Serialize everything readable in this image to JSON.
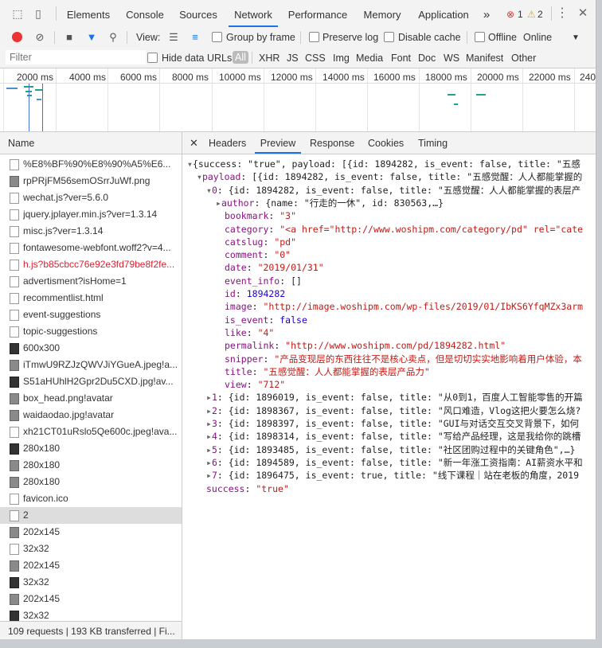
{
  "tabs": [
    "Elements",
    "Console",
    "Sources",
    "Network",
    "Performance",
    "Memory",
    "Application"
  ],
  "more_tabs": "»",
  "errors": "1",
  "warnings": "2",
  "toolbar": {
    "view_label": "View:",
    "group_by_frame": "Group by frame",
    "preserve_log": "Preserve log",
    "disable_cache": "Disable cache",
    "offline": "Offline",
    "throttle": "Online"
  },
  "filter": {
    "placeholder": "Filter",
    "hide_data_urls": "Hide data URLs",
    "types": [
      "All",
      "XHR",
      "JS",
      "CSS",
      "Img",
      "Media",
      "Font",
      "Doc",
      "WS",
      "Manifest",
      "Other"
    ]
  },
  "timeline_ticks": [
    "2000 ms",
    "4000 ms",
    "6000 ms",
    "8000 ms",
    "10000 ms",
    "12000 ms",
    "14000 ms",
    "16000 ms",
    "18000 ms",
    "20000 ms",
    "22000 ms",
    "240"
  ],
  "list": {
    "header": "Name",
    "rows": [
      "%E8%BF%90%E8%90%A5%E6...",
      "rpPRjFM56semOSrrJuWf.png",
      "wechat.js?ver=5.6.0",
      "jquery.jplayer.min.js?ver=1.3.14",
      "misc.js?ver=1.3.14",
      "fontawesome-webfont.woff2?v=4...",
      "h.js?b85cbcc76e92e3fd79be8f2fe...",
      "advertisment?isHome=1",
      "recommentlist.html",
      "event-suggestions",
      "topic-suggestions",
      "600x300",
      "iTmwU9RZJzQWVJiYGueA.jpeg!a...",
      "S51aHUhlH2Gpr2Du5CXD.jpg!av...",
      "box_head.png!avatar",
      "waidaodao.jpg!avatar",
      "xh21CT01uRslo5Qe600c.jpeg!ava...",
      "280x180",
      "280x180",
      "280x180",
      "favicon.ico",
      "2",
      "202x145",
      "32x32",
      "202x145",
      "32x32",
      "202x145",
      "32x32"
    ],
    "status": "109 requests | 193 KB transferred | Fi..."
  },
  "detail_tabs": [
    "Headers",
    "Preview",
    "Response",
    "Cookies",
    "Timing"
  ],
  "preview": {
    "l0": "{success: \"true\", payload: [{id: 1894282, is_event: false, title: \"五感",
    "l1_key": "payload",
    "l1_rest": ": [{id: 1894282, is_event: false, title: \"五感觉醒：人人都能掌握的",
    "l2_key": "0",
    "l2_rest": ": {id: 1894282, is_event: false, title: \"五感觉醒：人人都能掌握的表层产",
    "author_key": "author",
    "author_rest": ": {name: \"行走的一休\", id: 830563,…}",
    "bookmark_key": "bookmark",
    "bookmark_val": "\"3\"",
    "category_key": "category",
    "category_val": "\"<a href=\"http://www.woshipm.com/category/pd\" rel=\"cate",
    "catslug_key": "catslug",
    "catslug_val": "\"pd\"",
    "comment_key": "comment",
    "comment_val": "\"0\"",
    "date_key": "date",
    "date_val": "\"2019/01/31\"",
    "event_info_key": "event_info",
    "event_info_val": "[]",
    "id_key": "id",
    "id_val": "1894282",
    "image_key": "image",
    "image_val": "\"http://image.woshipm.com/wp-files/2019/01/IbKS6YfqMZx3arm",
    "is_event_key": "is_event",
    "is_event_val": "false",
    "like_key": "like",
    "like_val": "\"4\"",
    "permalink_key": "permalink",
    "permalink_val": "\"http://www.woshipm.com/pd/1894282.html\"",
    "snipper_key": "snipper",
    "snipper_val": "\"产品变现层的东西往往不是核心卖点，但是切切实实地影响着用户体验，本",
    "title_key": "title",
    "title_val": "\"五感觉醒：人人都能掌握的表层产品力\"",
    "view_key": "view",
    "view_val": "\"712\"",
    "items": [
      {
        "key": "1",
        "rest": ": {id: 1896019, is_event: false, title: \"从0到1，百度人工智能零售的开篇"
      },
      {
        "key": "2",
        "rest": ": {id: 1898367, is_event: false, title: \"风口难造，Vlog这把火要怎么烧?"
      },
      {
        "key": "3",
        "rest": ": {id: 1898397, is_event: false, title: \"GUI与对话交互交叉背景下，如何"
      },
      {
        "key": "4",
        "rest": ": {id: 1898314, is_event: false, title: \"写给产品经理，这是我给你的跳槽"
      },
      {
        "key": "5",
        "rest": ": {id: 1893485, is_event: false, title: \"社区团购过程中的关键角色\",…}"
      },
      {
        "key": "6",
        "rest": ": {id: 1894589, is_event: false, title: \"新一年涨工资指南：AI薪资水平和"
      },
      {
        "key": "7",
        "rest": ": {id: 1896475, is_event: true, title: \"线下课程｜站在老板的角度，2019"
      }
    ],
    "success_key": "success",
    "success_val": "\"true\""
  }
}
